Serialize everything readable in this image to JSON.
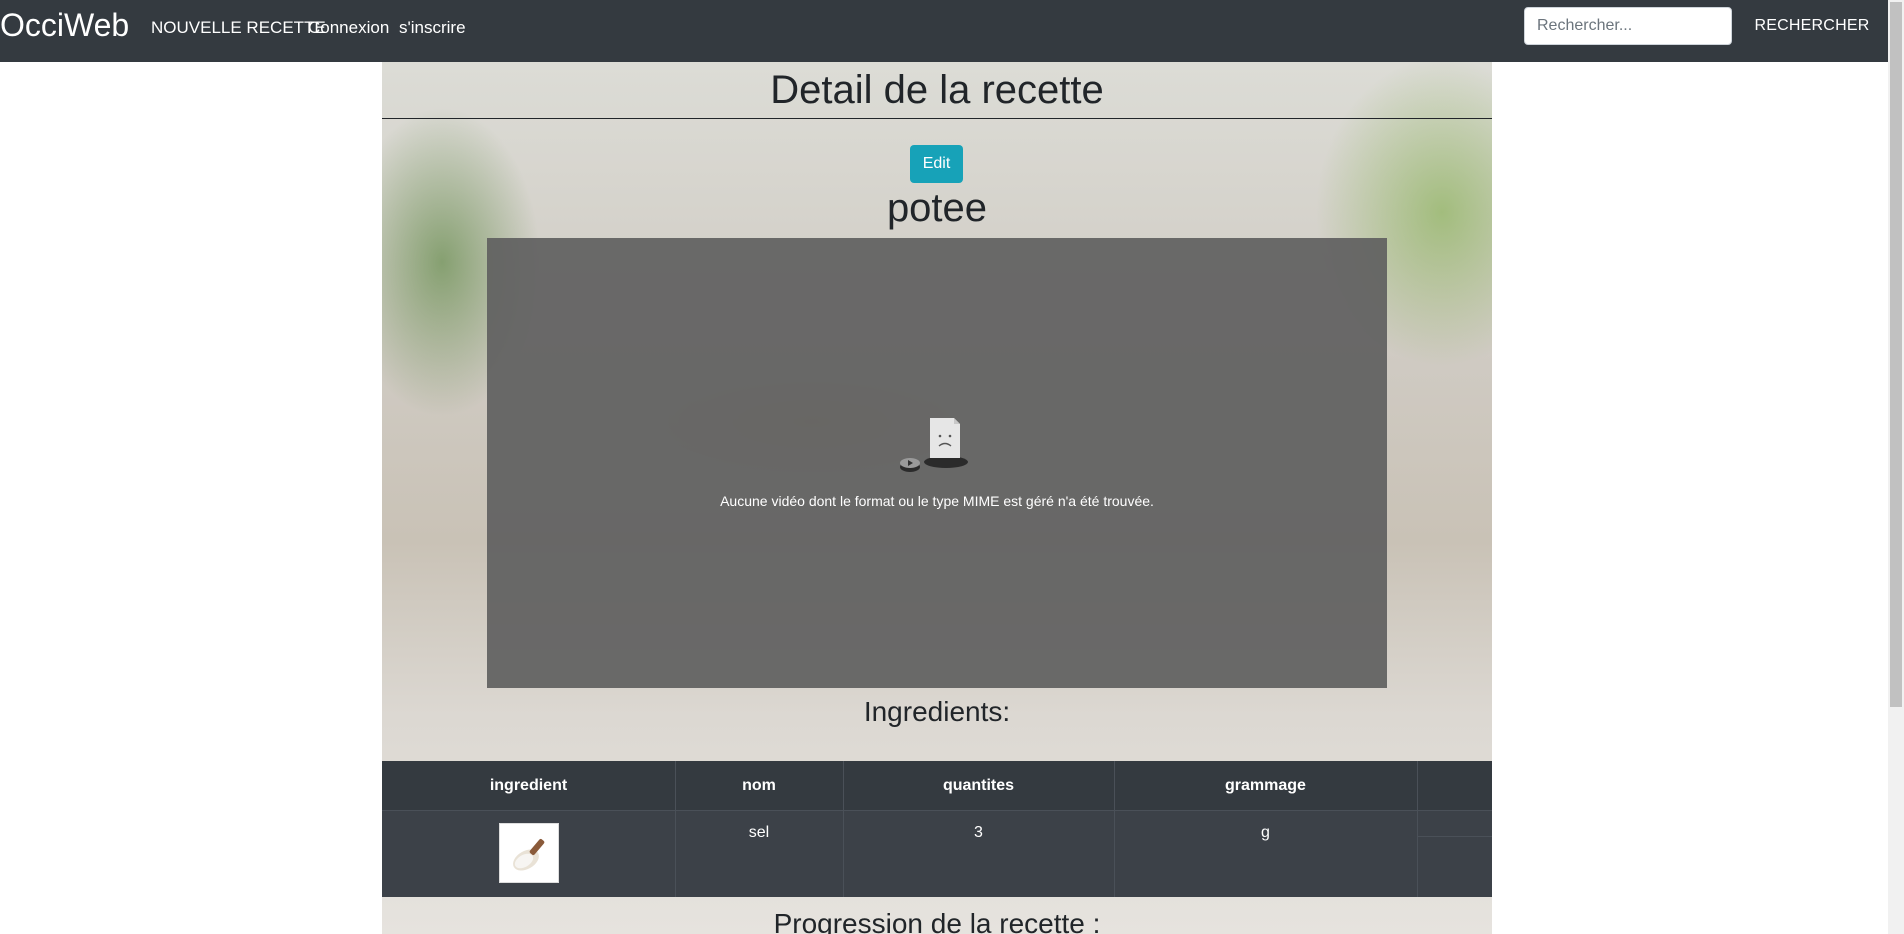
{
  "navbar": {
    "brand": "OcciWeb",
    "links": [
      {
        "label": "NOUVELLE RECETTE"
      },
      {
        "label": "Connexion"
      },
      {
        "label": "s'inscrire"
      }
    ],
    "search": {
      "placeholder": "Rechercher...",
      "value": ""
    },
    "search_button": "RECHERCHER"
  },
  "page": {
    "title": "Detail de la recette",
    "edit_label": "Edit",
    "recipe_name": "potee",
    "video": {
      "icon": "broken-video-file-icon",
      "message": "Aucune vidéo dont le format ou le type MIME est géré n'a été trouvée."
    },
    "ingredients_heading": "Ingredients:",
    "table": {
      "columns": [
        "ingredient",
        "nom",
        "quantites",
        "grammage",
        ""
      ],
      "rows": [
        {
          "image": "salt-scoop-image",
          "nom": "sel",
          "quantites": "3",
          "grammage": "g"
        }
      ]
    },
    "progress_heading": "Progression de la recette :"
  },
  "colors": {
    "navbar": "#343a40",
    "edit_button": "#17a2b8",
    "table_header": "#343a40",
    "table_body": "#3c4148"
  }
}
